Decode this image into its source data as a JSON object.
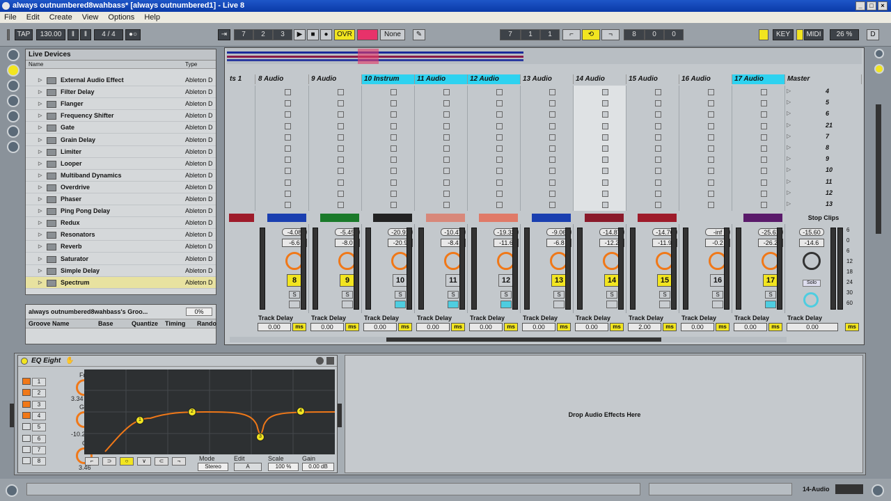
{
  "window": {
    "title": "always outnumbered8wahbass*  [always outnumbered1] - Live 8"
  },
  "menu": [
    "File",
    "Edit",
    "Create",
    "View",
    "Options",
    "Help"
  ],
  "transport": {
    "tap": "TAP",
    "tempo": "130.00",
    "signature": "4 / 4",
    "pos_bars": "7",
    "pos_beats": "2",
    "pos_sixteenths": "3",
    "ovr": "OVR",
    "quantize": "None",
    "loop_start_bars": "7",
    "loop_start_beats": "1",
    "loop_start_sixteenths": "1",
    "loop_len_bars": "8",
    "loop_len_beats": "0",
    "loop_len_sixteenths": "0",
    "key": "KEY",
    "midi": "MIDI",
    "cpu": "26 %",
    "d": "D"
  },
  "browser": {
    "title": "Live Devices",
    "col_name": "Name",
    "col_type": "Type",
    "items": [
      {
        "name": "External Audio Effect",
        "type": "Ableton D"
      },
      {
        "name": "Filter Delay",
        "type": "Ableton D"
      },
      {
        "name": "Flanger",
        "type": "Ableton D"
      },
      {
        "name": "Frequency Shifter",
        "type": "Ableton D"
      },
      {
        "name": "Gate",
        "type": "Ableton D"
      },
      {
        "name": "Grain Delay",
        "type": "Ableton D"
      },
      {
        "name": "Limiter",
        "type": "Ableton D"
      },
      {
        "name": "Looper",
        "type": "Ableton D"
      },
      {
        "name": "Multiband Dynamics",
        "type": "Ableton D"
      },
      {
        "name": "Overdrive",
        "type": "Ableton D"
      },
      {
        "name": "Phaser",
        "type": "Ableton D"
      },
      {
        "name": "Ping Pong Delay",
        "type": "Ableton D"
      },
      {
        "name": "Redux",
        "type": "Ableton D"
      },
      {
        "name": "Resonators",
        "type": "Ableton D"
      },
      {
        "name": "Reverb",
        "type": "Ableton D"
      },
      {
        "name": "Saturator",
        "type": "Ableton D"
      },
      {
        "name": "Simple Delay",
        "type": "Ableton D"
      },
      {
        "name": "Spectrum",
        "type": "Ableton D"
      }
    ]
  },
  "groove": {
    "title": "always outnumbered8wahbass's Groo...",
    "amount": "0%",
    "cols": [
      "Groove Name",
      "Base",
      "Quantize",
      "Timing",
      "Rando"
    ]
  },
  "tracks": [
    {
      "name": "ts 1",
      "volume": "",
      "pan": "",
      "num": "",
      "color": "#9e1b2a",
      "cyan": false,
      "armed": false,
      "yellow": false,
      "delay": "0.00"
    },
    {
      "name": "8 Audio",
      "volume": "-4.08",
      "pan": "-6.6",
      "num": "8",
      "color": "#1a3fb0",
      "cyan": false,
      "yellow": true,
      "delay": "0.00"
    },
    {
      "name": "9 Audio",
      "volume": "-5.45",
      "pan": "-8.0",
      "num": "9",
      "color": "#1a7a2a",
      "cyan": false,
      "yellow": true,
      "delay": "0.00"
    },
    {
      "name": "10 Instrum",
      "volume": "-20.91",
      "pan": "-20.9",
      "num": "10",
      "color": "#222222",
      "cyan": true,
      "yellow": false,
      "delay": "0.00"
    },
    {
      "name": "11 Audio",
      "volume": "-10.47",
      "pan": "-8.4",
      "num": "11",
      "color": "#d8887a",
      "cyan": true,
      "yellow": false,
      "delay": "0.00"
    },
    {
      "name": "12 Audio",
      "volume": "-19.33",
      "pan": "-11.6",
      "num": "12",
      "color": "#e07a68",
      "cyan": true,
      "yellow": false,
      "delay": "0.00"
    },
    {
      "name": "13 Audio",
      "volume": "-9.06",
      "pan": "-6.8",
      "num": "13",
      "color": "#1a3fb0",
      "cyan": false,
      "yellow": true,
      "delay": "0.00"
    },
    {
      "name": "14 Audio",
      "volume": "-14.87",
      "pan": "-12.2",
      "num": "14",
      "color": "#8a1a2a",
      "cyan": false,
      "yellow": true,
      "delay": "0.00"
    },
    {
      "name": "15 Audio",
      "volume": "-14.70",
      "pan": "-11.9",
      "num": "15",
      "color": "#9e1b2a",
      "cyan": false,
      "yellow": true,
      "delay": "2.00"
    },
    {
      "name": "16 Audio",
      "volume": "-inf",
      "pan": "-0.2",
      "num": "16",
      "color": "#c3c8cc",
      "cyan": false,
      "yellow": false,
      "delay": "0.00"
    },
    {
      "name": "17 Audio",
      "volume": "-25.61",
      "pan": "-26.2",
      "num": "17",
      "color": "#5a1a6a",
      "cyan": true,
      "yellow": true,
      "delay": "0.00"
    }
  ],
  "master": {
    "name": "Master",
    "volume": "-15.60",
    "pan": "-14.6",
    "stop_clips": "Stop Clips",
    "solo": "Solo",
    "delay": "0.00",
    "scenes": [
      "4",
      "5",
      "6",
      "21",
      "7",
      "8",
      "9",
      "10",
      "11",
      "12",
      "13"
    ],
    "meter_scale": [
      "6",
      "0",
      "6",
      "12",
      "18",
      "24",
      "30",
      "60"
    ]
  },
  "mixer_labels": {
    "track_delay": "Track Delay",
    "ms": "ms",
    "s": "S"
  },
  "eq": {
    "title": "EQ Eight",
    "bands": [
      "1",
      "2",
      "3",
      "4",
      "5",
      "6",
      "7",
      "8"
    ],
    "freq_label": "Freq",
    "freq_value": "3.34 kHz",
    "gain_label": "Gain",
    "gain_value": "-10.2 dB",
    "q_label": "Q",
    "q_value": "3.46",
    "mode_label": "Mode",
    "mode_value": "Stereo",
    "edit_label": "Edit",
    "edit_value": "A",
    "scale_label": "Scale",
    "scale_value": "100 %",
    "gain2_label": "Gain",
    "gain2_value": "0.00 dB",
    "nodes": [
      "1",
      "2",
      "3",
      "4"
    ]
  },
  "dropzone": {
    "text": "Drop Audio Effects Here"
  },
  "status": {
    "track": "14-Audio"
  }
}
